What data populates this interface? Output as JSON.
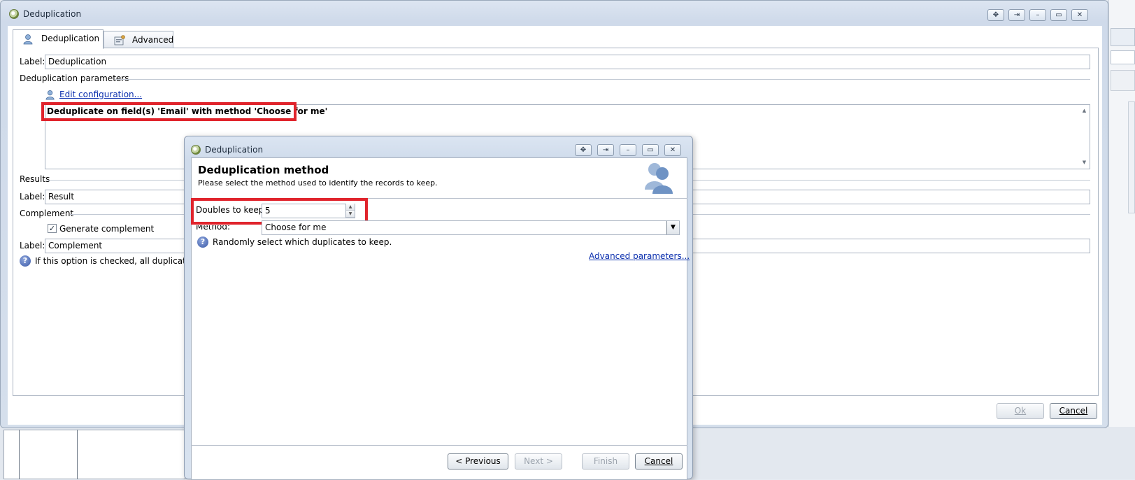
{
  "main_window": {
    "title": "Deduplication",
    "tabs": [
      {
        "label": "Deduplication",
        "icon": "user-icon"
      },
      {
        "label": "Advanced",
        "icon": "settings-form-icon"
      }
    ],
    "label_caption": "Label:",
    "label_value": "Deduplication",
    "dedup_section": "Deduplication parameters",
    "edit_config_link": "Edit configuration...",
    "dedup_summary": "Deduplicate on field(s) 'Email' with method 'Choose for me'",
    "results_section": "Results",
    "results_label_caption": "Label:",
    "results_label_value": "Result",
    "complement_section": "Complement",
    "generate_complement_label": "Generate complement",
    "generate_complement_checked": "✓",
    "complement_label_caption": "Label:",
    "complement_label_value": "Complement",
    "help_text": "If this option is checked, all duplicates ar",
    "ok_label": "Ok",
    "cancel_label": "Cancel"
  },
  "dialog": {
    "title": "Deduplication",
    "heading": "Deduplication method",
    "subheading": "Please select the method used to identify the records to keep.",
    "doubles_caption": "Doubles to keep:",
    "doubles_value": "5",
    "method_caption": "Method:",
    "method_value": "Choose for me",
    "method_help": "Randomly select which duplicates to keep.",
    "advanced_link": "Advanced parameters...",
    "previous_label": "< Previous",
    "next_label": "Next >",
    "finish_label": "Finish",
    "cancel_label": "Cancel"
  },
  "colors": {
    "highlight": "#e0242c",
    "link": "#0b2fae",
    "window_chrome": "#cfdaea"
  }
}
